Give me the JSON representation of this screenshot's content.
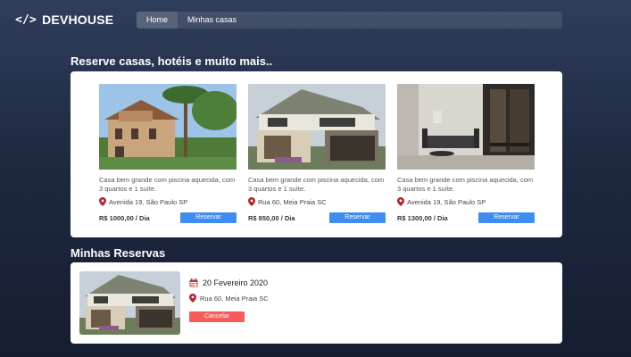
{
  "brand": {
    "icon": "code-icon",
    "icon_glyph": "</>",
    "name": "DEVHOUSE"
  },
  "nav": {
    "items": [
      {
        "label": "Home",
        "active": true
      },
      {
        "label": "Minhas casas",
        "active": false
      }
    ]
  },
  "listings_section": {
    "title": "Reserve casas, hotéis e muito mais..",
    "listings": [
      {
        "description": "Casa bem grande com piscina aquecida, com 3 quartos e 1 suíte.",
        "location": "Avenida 19, São Paulo SP",
        "price": "R$ 1000,00 / Dia",
        "button": "Reservar",
        "photo": "two-story-house-with-palm-trees"
      },
      {
        "description": "Casa bem grande com piscina aquecida, com 3 quartos e 1 suíte.",
        "location": "Rua 60,  Meia Praia SC",
        "price": "R$ 850,00 / Dia",
        "button": "Reservar",
        "photo": "modern-house-with-garage"
      },
      {
        "description": "Casa bem grande com piscina aquecida, com 3 quartos e 1 suíte.",
        "location": "Avenida 19, São Paulo SP",
        "price": "R$ 1300,00 / Dia",
        "button": "Reservar",
        "photo": "living-room-interior"
      }
    ]
  },
  "reservations_section": {
    "title": "Minhas Reservas",
    "reservation": {
      "date": "20 Fevereiro 2020",
      "location": "Rua 60,  Meia Praia SC",
      "cancel_label": "Cancelar",
      "photo": "modern-house-with-garage"
    }
  },
  "colors": {
    "reserve_button": "#3f8df0",
    "cancel_button": "#f45c5c",
    "pin": "#b4232c",
    "background_top": "#2f3e5c",
    "background_bottom": "#151d31"
  }
}
